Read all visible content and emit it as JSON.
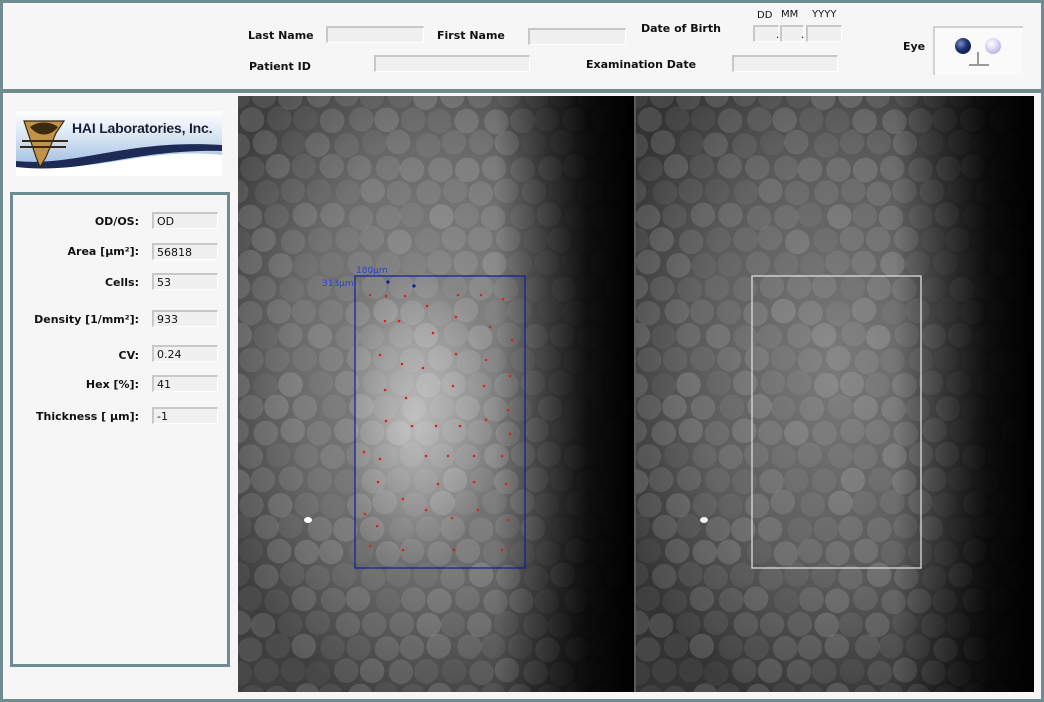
{
  "header": {
    "last_name_label": "Last Name",
    "first_name_label": "First Name",
    "dob_label": "Date of Birth",
    "patient_id_label": "Patient ID",
    "exam_date_label": "Examination Date",
    "eye_label": "Eye",
    "dob_dd": "DD",
    "dob_mm": "MM",
    "dob_yyyy": "YYYY",
    "dob_sep": ".",
    "last_name_value": "",
    "first_name_value": "",
    "patient_id_value": "",
    "exam_date_value": ""
  },
  "logo": {
    "text": "HAI Laboratories, Inc."
  },
  "results": {
    "items": [
      {
        "label": "OD/OS:",
        "value": "OD"
      },
      {
        "label": "Area [µm²]:",
        "value": "56818"
      },
      {
        "label": "Cells:",
        "value": "53"
      },
      {
        "label": "Density [1/mm²]:",
        "value": "933"
      },
      {
        "label": "CV:",
        "value": "0.24"
      },
      {
        "label": "Hex [%]:",
        "value": "41"
      },
      {
        "label": "Thickness [ µm]:",
        "value": "-1"
      }
    ]
  },
  "viewer": {
    "roi_width_label": "180µm",
    "roi_height_label": "313µm",
    "roi_color": "#0a1e9a",
    "marker_color": "#e02020",
    "roi_right_color": "#e0e0e0"
  },
  "colors": {
    "frame": "#708c90",
    "eye_right": "#c7c4ea",
    "eye_left": "#0b1a4a"
  }
}
